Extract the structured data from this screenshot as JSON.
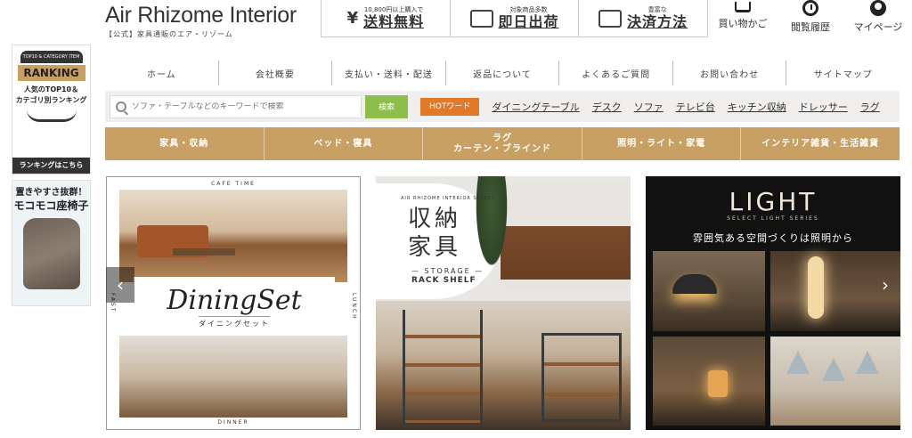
{
  "header": {
    "logo_title": "Air Rhizome Interior",
    "logo_sub": "【公式】家具通販のエア・リゾーム",
    "promo": [
      {
        "small": "10,800円以上購入で",
        "big": "送料無料",
        "icon": "yen-icon"
      },
      {
        "small": "対象商品多数",
        "big": "即日出荷",
        "icon": "truck-icon"
      },
      {
        "small": "豊富な",
        "big": "決済方法",
        "icon": "wallet-icon"
      }
    ],
    "links": [
      {
        "label": "買い物かご",
        "icon": "cart-icon"
      },
      {
        "label": "閲覧履歴",
        "icon": "clock-icon"
      },
      {
        "label": "マイページ",
        "icon": "user-icon"
      }
    ]
  },
  "sidebar": {
    "ranking_badge": "TOP10 & CATEGORY ITEM",
    "ranking_title": "RANKING",
    "ranking_desc1": "人気のTOP10＆",
    "ranking_desc2": "カテゴリ別ランキング",
    "ranking_button": "ランキングはこちら",
    "chair_t1": "置きやすさ抜群！",
    "chair_t2": "モコモコ座椅子"
  },
  "nav": [
    "ホーム",
    "会社概要",
    "支払い・送料・配送",
    "返品について",
    "よくあるご質問",
    "お問い合わせ",
    "サイトマップ"
  ],
  "search": {
    "placeholder": "ソファ・テーブルなどのキーワードで検索",
    "button": "検索",
    "hot_label": "HOTワード",
    "hot_words": [
      "ダイニングテーブル",
      "デスク",
      "ソファ",
      "テレビ台",
      "キッチン収納",
      "ドレッサー",
      "ラグ"
    ]
  },
  "categories": [
    {
      "label": "家具・収納"
    },
    {
      "label": "ベッド・寝具"
    },
    {
      "label": "ラグ\nカーテン・ブラインド"
    },
    {
      "label": "照明・ライト・家電"
    },
    {
      "label": "インテリア雑貨・生活雑貨"
    }
  ],
  "banners": {
    "dining": {
      "top": "CAFE TIME",
      "title": "DiningSet",
      "subtitle": "ダイニングセット",
      "bottom": "DINNER",
      "left": "FAST",
      "right": "LUNCH"
    },
    "storage": {
      "series": "AIR RHIZOME INTERIOR SELECT",
      "title1": "収納",
      "title2": "家具",
      "en1": "— STORAGE —",
      "en2": "RACK SHELF"
    },
    "light": {
      "title": "LIGHT",
      "series": "SELECT LIGHT SERIES",
      "sub": "雰囲気ある空間づくりは照明から"
    }
  },
  "slider": {
    "prev": "‹",
    "next": "›"
  }
}
